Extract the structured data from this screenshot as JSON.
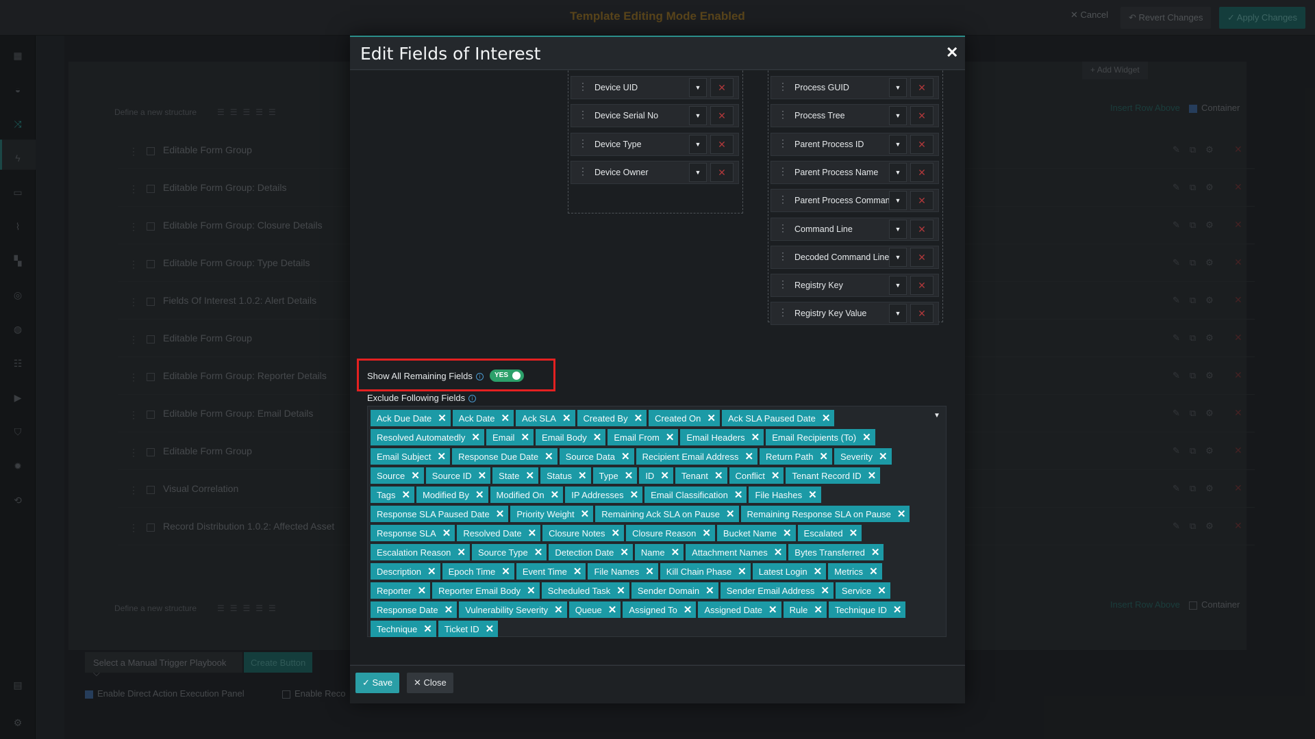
{
  "topbar": {
    "mode_text": "Template Editing Mode Enabled",
    "cancel_label": "Cancel",
    "revert_label": "Revert Changes",
    "apply_label": "Apply Changes"
  },
  "background": {
    "add_widget_label": "Add Widget",
    "define_structure_label": "Define a new structure",
    "insert_row_above_label": "Insert Row Above",
    "container_label": "Container",
    "rows": [
      "Editable Form Group",
      "Editable Form Group: Details",
      "Editable Form Group: Closure Details",
      "Editable Form Group: Type Details",
      "Fields Of Interest 1.0.2: Alert Details",
      "Editable Form Group",
      "Editable Form Group: Reporter Details",
      "Editable Form Group: Email Details",
      "Editable Form Group",
      "Visual Correlation",
      "Record Distribution 1.0.2: Affected Asset"
    ],
    "playbook_select_label": "Select a Manual Trigger Playbook",
    "create_button_label": "Create Button",
    "enable_direct_action_label": "Enable Direct Action Execution Panel",
    "enable_reco_label": "Enable Reco"
  },
  "modal": {
    "title": "Edit Fields of Interest",
    "left_column_fields": [
      "Device UID",
      "Device Serial No",
      "Device Type",
      "Device Owner"
    ],
    "right_column_fields": [
      "Process GUID",
      "Process Tree",
      "Parent Process ID",
      "Parent Process Name",
      "Parent Process Command Line",
      "Command Line",
      "Decoded Command Line",
      "Registry Key",
      "Registry Key Value"
    ],
    "show_all_label": "Show All Remaining Fields",
    "toggle_label": "YES",
    "exclude_label": "Exclude Following Fields",
    "excluded_fields": [
      "Ack Due Date",
      "Ack Date",
      "Ack SLA",
      "Created By",
      "Created On",
      "Ack SLA Paused Date",
      "Resolved Automatedly",
      "Email",
      "Email Body",
      "Email From",
      "Email Headers",
      "Email Recipients (To)",
      "Email Subject",
      "Response Due Date",
      "Source Data",
      "Recipient Email Address",
      "Return Path",
      "Severity",
      "Source",
      "Source ID",
      "State",
      "Status",
      "Type",
      "ID",
      "Tenant",
      "Conflict",
      "Tenant Record ID",
      "Tags",
      "Modified By",
      "Modified On",
      "IP Addresses",
      "Email Classification",
      "File Hashes",
      "Response SLA Paused Date",
      "Priority Weight",
      "Remaining Ack SLA on Pause",
      "Remaining Response SLA on Pause",
      "Response SLA",
      "Resolved Date",
      "Closure Notes",
      "Closure Reason",
      "Bucket Name",
      "Escalated",
      "Escalation Reason",
      "Source Type",
      "Detection Date",
      "Name",
      "Attachment Names",
      "Bytes Transferred",
      "Description",
      "Epoch Time",
      "Event Time",
      "File Names",
      "Kill Chain Phase",
      "Latest Login",
      "Metrics",
      "Reporter",
      "Reporter Email Body",
      "Scheduled Task",
      "Sender Domain",
      "Sender Email Address",
      "Service",
      "Response Date",
      "Vulnerability Severity",
      "Queue",
      "Assigned To",
      "Assigned Date",
      "Rule",
      "Technique ID",
      "Technique",
      "Ticket ID"
    ],
    "save_label": "Save",
    "close_label": "Close"
  },
  "colors": {
    "accent": "#1c9aa6",
    "toggle_on": "#2ca06a",
    "highlight": "#e42121",
    "remove": "#b0383b"
  }
}
